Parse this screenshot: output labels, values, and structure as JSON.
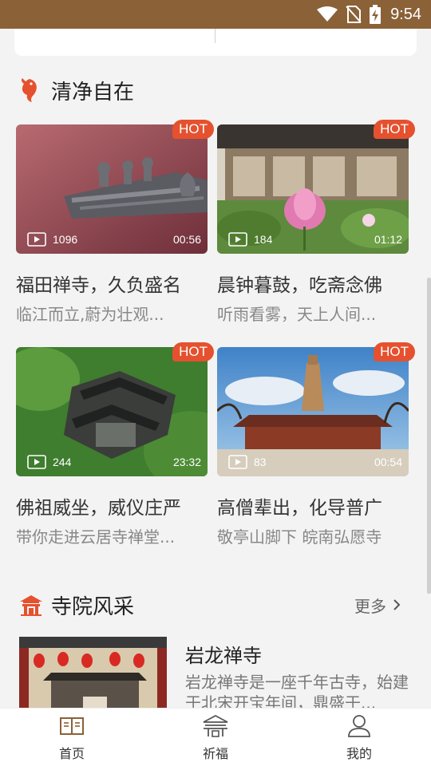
{
  "status_bar": {
    "time": "9:54",
    "icons": [
      "wifi-icon",
      "no-sim-icon",
      "battery-charging-icon"
    ]
  },
  "sections": {
    "clean": {
      "title": "清净自在",
      "icon": "koi-fish-icon"
    },
    "temples": {
      "title": "寺院风采",
      "icon": "temple-icon",
      "more_label": "更多"
    }
  },
  "videos": [
    {
      "badge": "HOT",
      "views": "1096",
      "duration": "00:56",
      "title": "福田禅寺，久负盛名",
      "subtitle": "临江而立,蔚为壮观..."
    },
    {
      "badge": "HOT",
      "views": "184",
      "duration": "01:12",
      "title": "晨钟暮鼓，吃斋念佛",
      "subtitle": "听雨看雾，天上人间..."
    },
    {
      "badge": "HOT",
      "views": "244",
      "duration": "23:32",
      "title": "佛祖威坐，威仪庄严",
      "subtitle": "带你走进云居寺禅堂..."
    },
    {
      "badge": "HOT",
      "views": "83",
      "duration": "00:54",
      "title": "高僧辈出，化导普广",
      "subtitle": "敬亭山脚下 皖南弘愿寺"
    }
  ],
  "temple": {
    "name": "岩龙禅寺",
    "description": "岩龙禅寺是一座千年古寺，始建于北宋开宝年间，鼎盛于..."
  },
  "tabs": [
    {
      "label": "首页",
      "icon": "book-icon",
      "active": true
    },
    {
      "label": "祈福",
      "icon": "pavilion-icon",
      "active": false
    },
    {
      "label": "我的",
      "icon": "user-icon",
      "active": false
    }
  ],
  "colors": {
    "status_bar": "#8b6138",
    "accent": "#e5512f",
    "tab_active": "#8b6138"
  }
}
